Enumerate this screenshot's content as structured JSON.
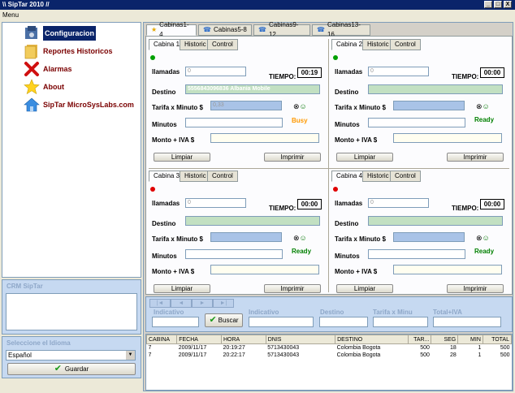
{
  "window": {
    "title": "\\\\ SipTar 2010 //",
    "min": "_",
    "max": "□",
    "close": "X"
  },
  "menu": {
    "label": "Menu"
  },
  "nav": {
    "items": [
      {
        "label": "Configuracion"
      },
      {
        "label": "Reportes Historicos"
      },
      {
        "label": "Alarmas"
      },
      {
        "label": "About"
      },
      {
        "label": "SipTar MicroSysLabs.com"
      }
    ]
  },
  "crm": {
    "title": "CRM SipTar"
  },
  "language": {
    "title": "Seleccione el Idioma",
    "selected": "Español",
    "save_label": "Guardar"
  },
  "tabs": [
    "Cabinas1-4",
    "Cabinas5-8",
    "Cabinas9-12",
    "Cabinas13-16"
  ],
  "cabin_labels": {
    "historic": "Historic",
    "control": "Control",
    "llamadas": "llamadas",
    "tiempo": "TIEMPO:",
    "destino": "Destino",
    "tarifa": "Tarifa x Minuto $",
    "minutos": "Minutos",
    "monto": "Monto + IVA $",
    "limpiar": "Limpiar",
    "imprimir": "Imprimir"
  },
  "cabins": [
    {
      "name": "Cabina 1",
      "llamadas": "0",
      "tiempo": "00:19",
      "destino": "5556843096836  Albania Mobile",
      "tarifa": "0,33",
      "status": "Busy",
      "status_color": "#ff9900",
      "dot_color": "#00a000"
    },
    {
      "name": "Cabina 2",
      "llamadas": "0",
      "tiempo": "00:00",
      "destino": "",
      "tarifa": "",
      "status": "Ready",
      "status_color": "#008000",
      "dot_color": "#00a000"
    },
    {
      "name": "Cabina 3",
      "llamadas": "0",
      "tiempo": "00:00",
      "destino": "",
      "tarifa": "",
      "status": "Ready",
      "status_color": "#008000",
      "dot_color": "#e00000"
    },
    {
      "name": "Cabina 4",
      "llamadas": "0",
      "tiempo": "00:00",
      "destino": "",
      "tarifa": "",
      "status": "Ready",
      "status_color": "#008000",
      "dot_color": "#e00000"
    }
  ],
  "filter": {
    "nav_buttons": [
      "|◄",
      "◄",
      "►",
      "►|"
    ],
    "indicativo1": "Indicativo",
    "buscar": "Buscar",
    "indicativo2": "Indicativo",
    "destino": "Destino",
    "tarifa": "Tarifa x Minu",
    "total": "Total+IVA"
  },
  "table": {
    "columns": [
      "CABINA",
      "FECHA",
      "HORA",
      "DNIS",
      "DESTINO",
      "TAR...",
      "SEG",
      "MIN",
      "TOTAL"
    ],
    "rows": [
      [
        "7",
        "2009/11/17",
        "20:19:27",
        "5713430043",
        "Colombia Bogota",
        "500",
        "18",
        "1",
        "500"
      ],
      [
        "7",
        "2009/11/17",
        "20:22:17",
        "5713430043",
        "Colombia Bogota",
        "500",
        "28",
        "1",
        "500"
      ]
    ]
  }
}
